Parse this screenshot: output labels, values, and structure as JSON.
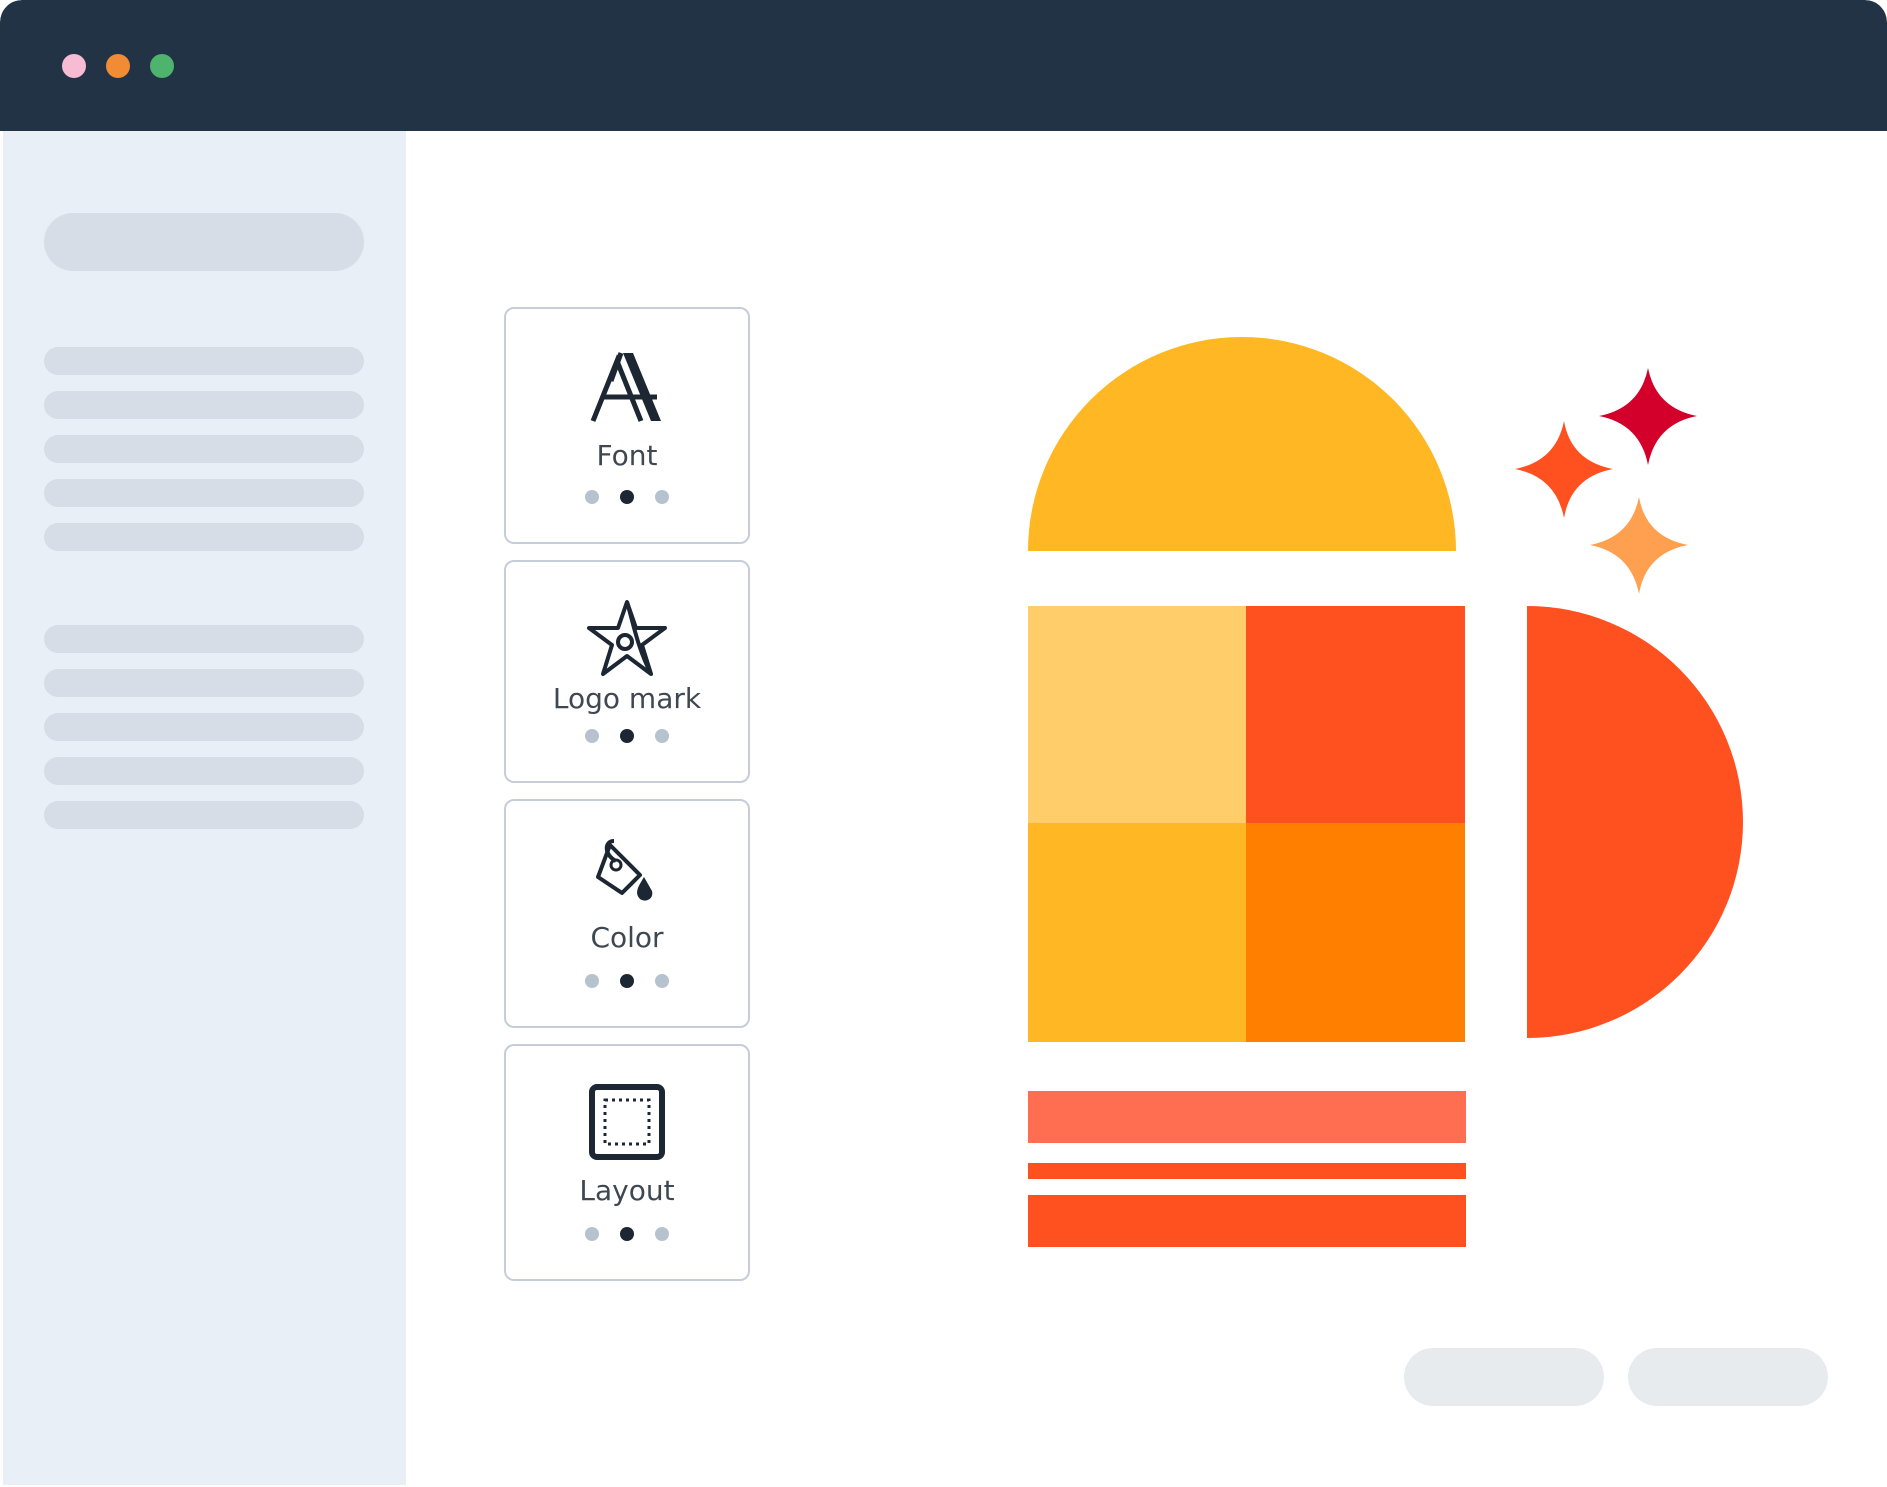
{
  "window": {
    "traffic_lights": [
      {
        "name": "close",
        "color": "#f7bcd3"
      },
      {
        "name": "minimize",
        "color": "#f28c34"
      },
      {
        "name": "zoom",
        "color": "#4db36d"
      }
    ]
  },
  "panel": {
    "cards": [
      {
        "label": "Font",
        "icon": "font-icon",
        "dots": 3,
        "active_dot": 2
      },
      {
        "label": "Logo mark",
        "icon": "logo-mark-icon",
        "dots": 3,
        "active_dot": 2
      },
      {
        "label": "Color",
        "icon": "paint-bucket-icon",
        "dots": 3,
        "active_dot": 2
      },
      {
        "label": "Layout",
        "icon": "layout-icon",
        "dots": 3,
        "active_dot": 2
      }
    ]
  },
  "colors": {
    "titlebar": "#233346",
    "sidebar": "#e8eff7",
    "skeleton": "#d6dde6",
    "yellow": "#ffb823",
    "light_yellow": "#ffcd6a",
    "red_orange": "#ff5020",
    "orange": "#ff8000",
    "salmon": "#ff6e50",
    "crimson": "#d2002a",
    "peach": "#ffa050",
    "button_placeholder": "#e8ebee"
  }
}
